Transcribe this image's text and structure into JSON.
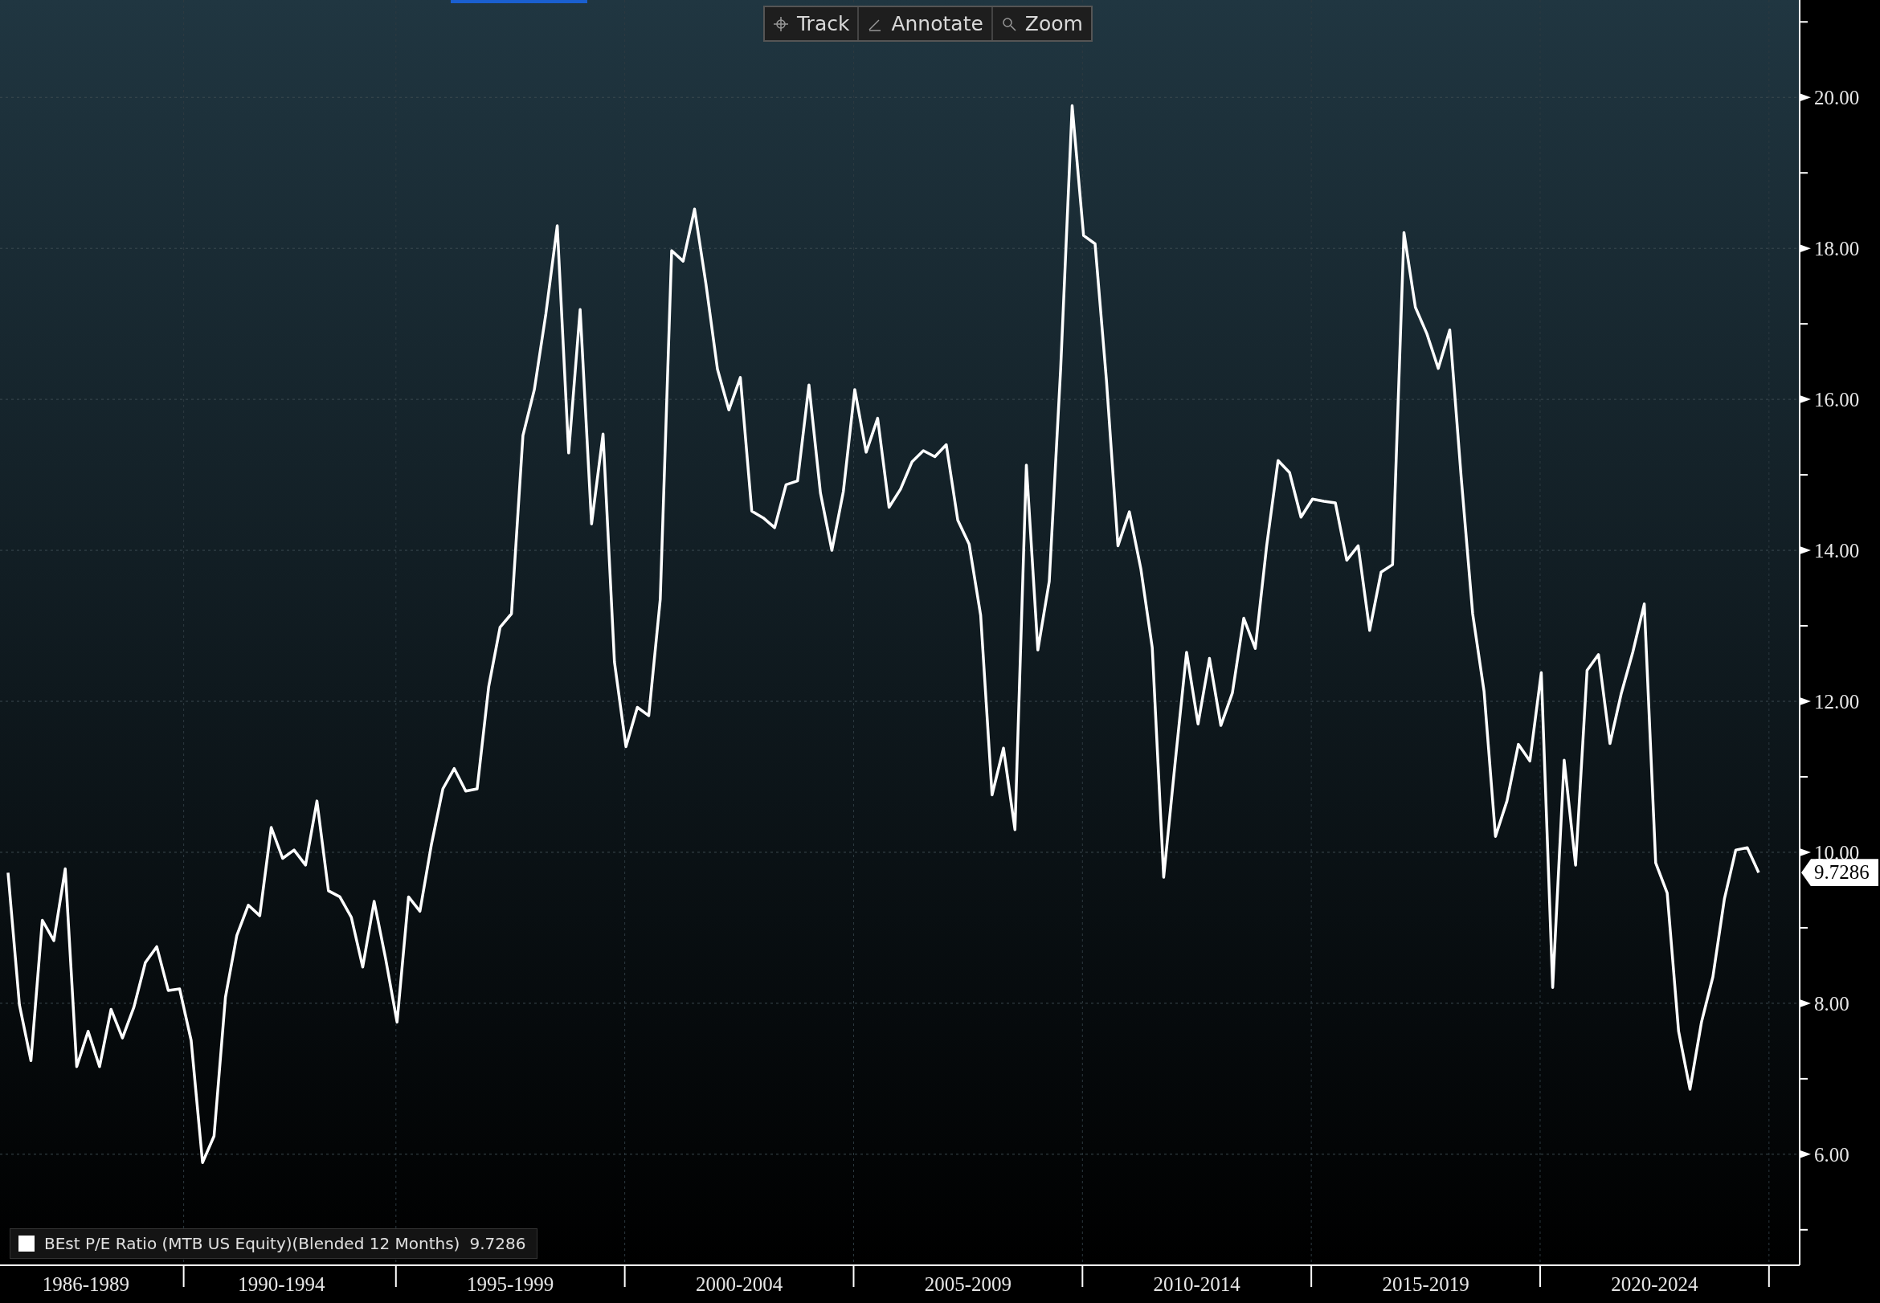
{
  "toolbar": {
    "buttons": [
      {
        "label": "Track",
        "kind": "track"
      },
      {
        "label": "Annotate",
        "kind": "annotate"
      },
      {
        "label": "Zoom",
        "kind": "zoom"
      }
    ]
  },
  "chart": {
    "chart_data": {
      "type": "line",
      "ylim": [
        4.53,
        21.29
      ],
      "yticks": [
        {
          "value": 6,
          "label": "6.00"
        },
        {
          "value": 8,
          "label": "8.00"
        },
        {
          "value": 10,
          "label": "10.00"
        },
        {
          "value": 12,
          "label": "12.00"
        },
        {
          "value": 14,
          "label": "14.00"
        },
        {
          "value": 16,
          "label": "16.00"
        },
        {
          "value": 18,
          "label": "18.00"
        },
        {
          "value": 20,
          "label": "20.00"
        }
      ],
      "grid": true,
      "series": [
        {
          "name": "BEst P/E Ratio (MTB US Equity)(Blended 12 Months)",
          "color": "#ffffff",
          "values": [
            9.73,
            7.98,
            7.24,
            9.1,
            8.83,
            9.78,
            7.16,
            7.63,
            7.16,
            7.92,
            7.54,
            7.95,
            8.54,
            8.75,
            8.17,
            8.19,
            7.51,
            5.89,
            6.24,
            8.08,
            8.9,
            9.3,
            9.16,
            10.33,
            9.92,
            10.03,
            9.83,
            10.68,
            9.49,
            9.41,
            9.14,
            8.48,
            9.35,
            8.59,
            7.75,
            9.41,
            9.22,
            10.1,
            10.84,
            11.11,
            10.81,
            10.84,
            12.19,
            12.98,
            13.16,
            15.52,
            16.13,
            17.13,
            18.3,
            15.29,
            17.19,
            14.35,
            15.54,
            12.52,
            11.4,
            11.92,
            11.81,
            13.35,
            17.97,
            17.83,
            18.52,
            17.52,
            16.4,
            15.86,
            16.29,
            14.52,
            14.43,
            14.3,
            14.87,
            14.92,
            16.19,
            14.76,
            14.0,
            14.78,
            16.13,
            15.3,
            15.75,
            14.57,
            14.81,
            15.17,
            15.32,
            15.24,
            15.4,
            14.4,
            14.08,
            13.14,
            10.76,
            11.38,
            10.3,
            15.13,
            12.68,
            13.59,
            16.41,
            19.89,
            18.17,
            18.06,
            16.25,
            14.06,
            14.51,
            13.76,
            12.71,
            9.67,
            11.19,
            12.65,
            11.7,
            12.57,
            11.68,
            12.11,
            13.1,
            12.7,
            14.06,
            15.19,
            15.03,
            14.44,
            14.68,
            14.65,
            14.63,
            13.87,
            14.06,
            12.94,
            13.71,
            13.81,
            18.21,
            17.22,
            16.87,
            16.41,
            16.92,
            14.97,
            13.16,
            12.13,
            10.21,
            10.68,
            11.43,
            11.21,
            12.38,
            8.21,
            11.22,
            9.83,
            12.41,
            12.62,
            11.44,
            12.11,
            12.65,
            13.29,
            9.86,
            9.46,
            7.63,
            6.86,
            7.75,
            8.35,
            9.38,
            10.03,
            10.06,
            9.73
          ]
        }
      ]
    },
    "x_axis_labels": [
      "1986-1989",
      "1990-1994",
      "1995-1999",
      "2000-2004",
      "2005-2009",
      "2010-2014",
      "2015-2019",
      "2020-2024"
    ],
    "last_value": "9.7286",
    "legend": {
      "value": "9.7286"
    }
  }
}
